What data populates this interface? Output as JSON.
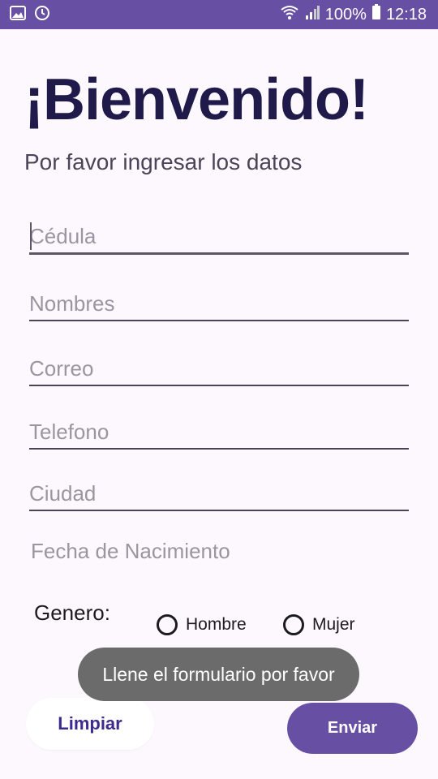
{
  "status_bar": {
    "battery": "100%",
    "time": "12:18",
    "left_icons": [
      "image-icon",
      "sync-icon"
    ],
    "right_icons": [
      "wifi-icon",
      "signal-icon",
      "battery-icon"
    ]
  },
  "header": {
    "title": "¡Bienvenido!",
    "subtitle": "Por favor ingresar los datos"
  },
  "form": {
    "cedula_placeholder": "Cédula",
    "nombres_placeholder": "Nombres",
    "correo_placeholder": "Correo",
    "telefono_placeholder": "Telefono",
    "ciudad_placeholder": "Ciudad",
    "fecha_label": "Fecha de Nacimiento",
    "genero_label": "Genero:",
    "genero_options": [
      "Hombre",
      "Mujer"
    ]
  },
  "toast": {
    "message": "Llene el formulario por favor"
  },
  "buttons": {
    "limpiar": "Limpiar",
    "enviar": "Enviar"
  },
  "colors": {
    "primary": "#6750a4",
    "title": "#1f1a4a",
    "background": "#fdf8fd",
    "toast_bg": "#6b6b6b"
  }
}
